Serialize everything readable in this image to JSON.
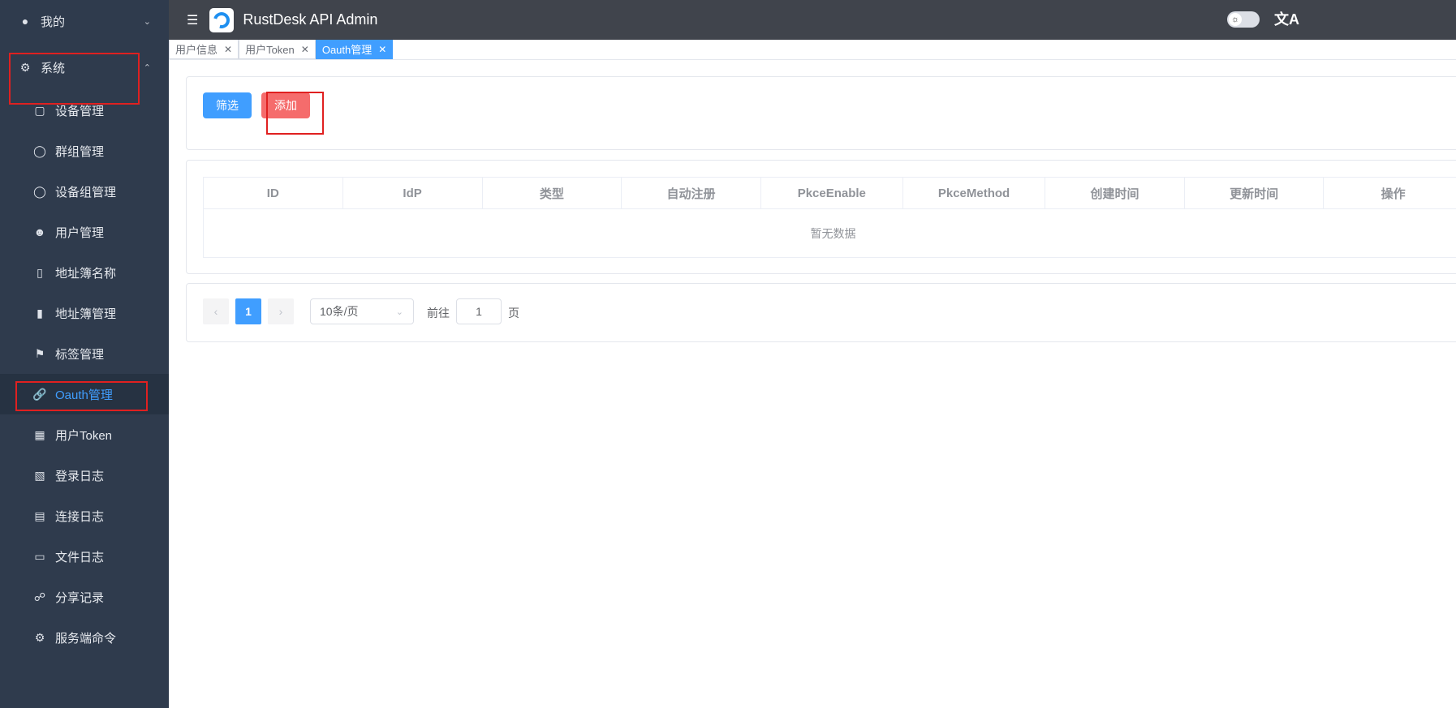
{
  "sidebar": {
    "groups": [
      {
        "label": "我的",
        "icon": "user-icon"
      },
      {
        "label": "系统",
        "icon": "gear-icon"
      }
    ],
    "items": [
      {
        "label": "设备管理",
        "icon": "monitor-icon"
      },
      {
        "label": "群组管理",
        "icon": "chat-icon"
      },
      {
        "label": "设备组管理",
        "icon": "chat-icon"
      },
      {
        "label": "用户管理",
        "icon": "user-outline-icon"
      },
      {
        "label": "地址簿名称",
        "icon": "notebook-icon"
      },
      {
        "label": "地址簿管理",
        "icon": "book-icon"
      },
      {
        "label": "标签管理",
        "icon": "bookmark-icon"
      },
      {
        "label": "Oauth管理",
        "icon": "link-icon",
        "active": true
      },
      {
        "label": "用户Token",
        "icon": "ticket-icon"
      },
      {
        "label": "登录日志",
        "icon": "clipboard-icon"
      },
      {
        "label": "连接日志",
        "icon": "document-icon"
      },
      {
        "label": "文件日志",
        "icon": "folder-icon"
      },
      {
        "label": "分享记录",
        "icon": "share-icon"
      },
      {
        "label": "服务端命令",
        "icon": "cog-icon"
      }
    ]
  },
  "header": {
    "title": "RustDesk API Admin",
    "lang_icon": "文A"
  },
  "tabs": [
    {
      "label": "用户信息"
    },
    {
      "label": "用户Token"
    },
    {
      "label": "Oauth管理",
      "active": true
    }
  ],
  "toolbar": {
    "filter_label": "筛选",
    "add_label": "添加"
  },
  "table": {
    "columns": [
      "ID",
      "IdP",
      "类型",
      "自动注册",
      "PkceEnable",
      "PkceMethod",
      "创建时间",
      "更新时间",
      "操作"
    ],
    "empty_text": "暂无数据"
  },
  "pagination": {
    "current_page": "1",
    "page_size": "10条/页",
    "goto_label": "前往",
    "goto_value": "1",
    "page_unit": "页"
  },
  "colors": {
    "accent": "#409eff",
    "danger": "#f56c6c",
    "sidebar": "#2f3b4d",
    "header": "#40444c"
  }
}
